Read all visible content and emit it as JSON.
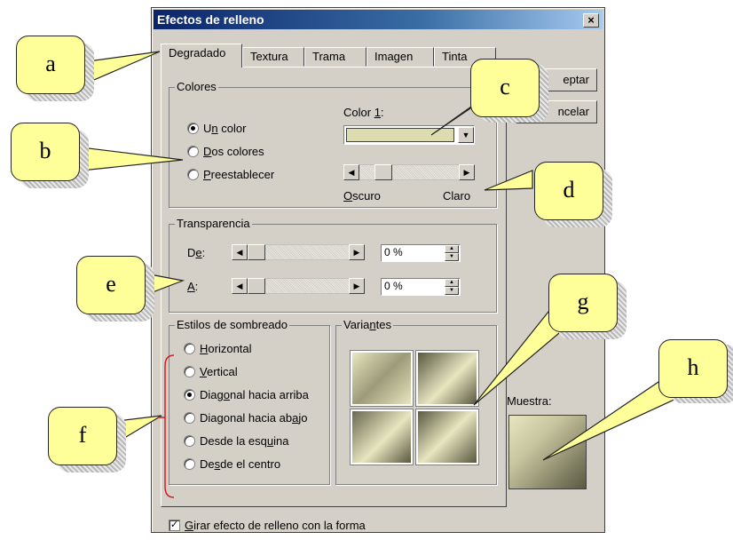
{
  "dialog": {
    "title": "Efectos de relleno",
    "close": "×"
  },
  "tabs": [
    "Degradado",
    "Textura",
    "Trama",
    "Imagen",
    "Tinta"
  ],
  "buttons": {
    "ok": "eptar",
    "cancel": "ncelar"
  },
  "colores": {
    "legend": "Colores",
    "options": [
      {
        "pre": "U",
        "key": "n",
        "post": " color",
        "checked": true
      },
      {
        "pre": "",
        "key": "D",
        "post": "os colores",
        "checked": false
      },
      {
        "pre": "",
        "key": "P",
        "post": "reestablecer",
        "checked": false
      }
    ],
    "color1_pre": "Color ",
    "color1_key": "1",
    "color1_post": ":",
    "color1_value": "#dcdcb0",
    "dark_key": "O",
    "dark_rest": "scuro",
    "light": "Claro"
  },
  "transparencia": {
    "legend": "Transparencia",
    "de_pre": "De",
    "de_key": "",
    "de_label": "De:",
    "a_key": "A",
    "a_post": ":",
    "de_value": "0 %",
    "a_value": "0 %"
  },
  "sombreado": {
    "legend": "Estilos de sombreado",
    "options": [
      {
        "pre": "",
        "key": "H",
        "post": "orizontal",
        "checked": false
      },
      {
        "pre": "",
        "key": "V",
        "post": "ertical",
        "checked": false
      },
      {
        "pre": "Diag",
        "key": "o",
        "post": "nal hacia arriba",
        "checked": true
      },
      {
        "pre": "Diagonal hacia ab",
        "key": "a",
        "post": "jo",
        "checked": false
      },
      {
        "pre": "Desde la esq",
        "key": "u",
        "post": "ina",
        "checked": false
      },
      {
        "pre": "De",
        "key": "s",
        "post": "de el centro",
        "checked": false
      }
    ]
  },
  "variantes": {
    "legend_pre": "Varia",
    "legend_key": "n",
    "legend_post": "tes"
  },
  "muestra": {
    "label": "Muestra:"
  },
  "rotate": {
    "key": "G",
    "rest": "irar efecto de relleno con la forma",
    "checked": true
  },
  "callouts": [
    "a",
    "b",
    "c",
    "d",
    "e",
    "f",
    "g",
    "h"
  ],
  "colors": {
    "callout_fill": "#ffff99",
    "title_bar": "#0a246a",
    "dialog_bg": "#d4d0c8",
    "gradient_light": "#e8e6c0",
    "gradient_dark": "#5a5840"
  }
}
